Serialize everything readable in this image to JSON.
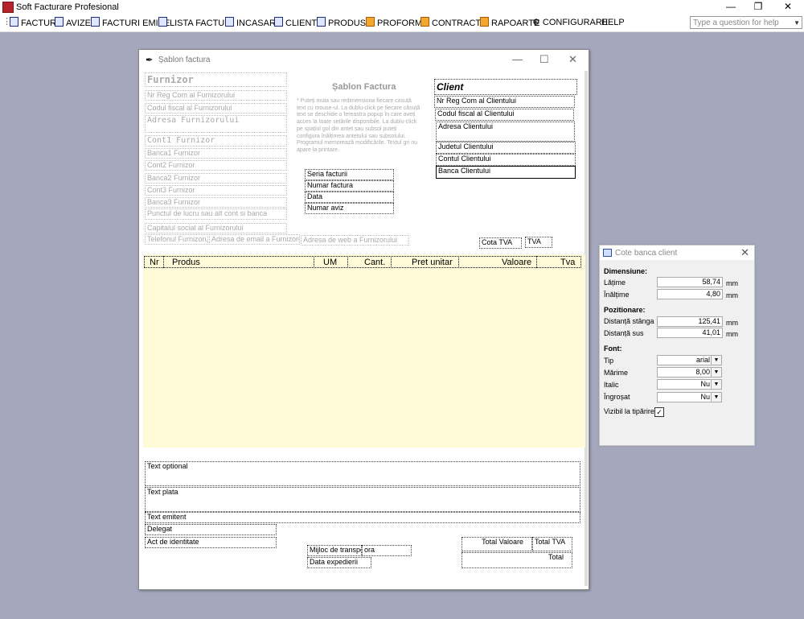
{
  "app": {
    "title": "Soft Facturare Profesional"
  },
  "menu": [
    {
      "label": "FACTURI",
      "icon": "facturi-icon"
    },
    {
      "label": "AVIZE",
      "icon": "avize-icon"
    },
    {
      "label": "FACTURI EMISE",
      "icon": "facturi-emise-icon"
    },
    {
      "label": "LISTA FACTURI",
      "icon": "lista-facturi-icon"
    },
    {
      "label": "INCASARI",
      "icon": "incasari-icon"
    },
    {
      "label": "CLIENTI",
      "icon": "clienti-icon"
    },
    {
      "label": "PRODUSE",
      "icon": "produse-icon"
    },
    {
      "label": "PROFORME",
      "icon": "proforme-icon"
    },
    {
      "label": "CONTRACTE",
      "icon": "contracte-icon"
    },
    {
      "label": "RAPOARTE",
      "icon": "rapoarte-icon"
    },
    {
      "label": "CONFIGURARE",
      "icon": "configurare-icon"
    },
    {
      "label": "HELP",
      "icon": ""
    }
  ],
  "help_search": {
    "placeholder": "Type a question for help"
  },
  "window": {
    "title": "Șablon factura",
    "heading": "Șablon Factura",
    "instructions": "* Puteți muta sau redimensiona fiecare casuță text cu mouse-ul. La dublu-click pe fiecare căsuță text se deschide o fereastra popup în care aveți acces la toate setările disponibile. La dublu-click pe spațiul gol din antet sau subsol puteți configura înălțimea antetului sau subsolului. Programul memorează modificările. Textul gri nu apare la printare.",
    "supplier": {
      "furnizor": "Furnizor",
      "nr_reg": "Nr Reg Com al Furnizorului",
      "cod_fiscal": "Codul fiscal al Furnizorului",
      "adresa": "Adresa Furnizorului",
      "cont1": "Cont1 Furnizor",
      "banca1": "Banca1 Furnizor",
      "cont2": "Cont2 Furnizor",
      "banca2": "Banca2 Furnizor",
      "cont3": "Cont3 Furnizor",
      "banca3": "Banca3 Furnizor",
      "punct_lucru": "Punctul de lucru sau alt cont si banca",
      "capital": "Capitalul social al Furnizorului",
      "telefon": "Telefonul Furnizorul",
      "email": "Adresa de email a Furnizorului",
      "web": "Adresa de web a Furnizorului"
    },
    "client": {
      "client": "Client",
      "nr_reg": "Nr Reg Com al Clientului",
      "cod_fiscal": "Codul fiscal al Clientului",
      "adresa": "Adresa Clientului",
      "judet": "Judetul Clientului",
      "cont": "Contul Clientului",
      "banca": "Banca Clientului"
    },
    "invoice": {
      "seria": "Seria facturii",
      "numar": "Numar factura",
      "data": "Data",
      "aviz": "Numar aviz",
      "cota_tva": "Cota TVA",
      "tva": "TVA"
    },
    "table": {
      "headers": [
        "Nr",
        "Produs",
        "UM",
        "Cant.",
        "Pret unitar",
        "Valoare",
        "Tva"
      ]
    },
    "footer": {
      "text_optional": "Text optional",
      "text_plata": "Text plata",
      "text_emitent": "Text emitent",
      "delegat": "Delegat",
      "act_identitate": "Act de identitate",
      "mijloc_transport": "Mijloc de transport",
      "ora": "ora",
      "data_expedierii": "Data expedierii",
      "total_valoare": "Total Valoare",
      "total_tva": "Total TVA",
      "total": "Total"
    }
  },
  "side_panel": {
    "title": "Cote banca client",
    "dimensiune": "Dimensiune:",
    "latime_label": "Lățime",
    "latime_value": "58,74",
    "inaltime_label": "Înălțime",
    "inaltime_value": "4,80",
    "pozitionare": "Pozitionare:",
    "stanga_label": "Distanță stânga",
    "stanga_value": "125,41",
    "sus_label": "Distanță sus",
    "sus_value": "41,01",
    "unit": "mm",
    "font": "Font:",
    "tip_label": "Tip",
    "tip_value": "arial",
    "marime_label": "Mărime",
    "marime_value": "8,00",
    "italic_label": "Italic",
    "italic_value": "Nu",
    "ingrosat_label": "Îngroșat",
    "ingrosat_value": "Nu",
    "vizibil_label": "Vizibil la tipărire",
    "vizibil_checked": true
  },
  "colors": {
    "background": "#a5a7bd",
    "table_area": "#fffbd9",
    "panel": "#f0f0f0"
  }
}
